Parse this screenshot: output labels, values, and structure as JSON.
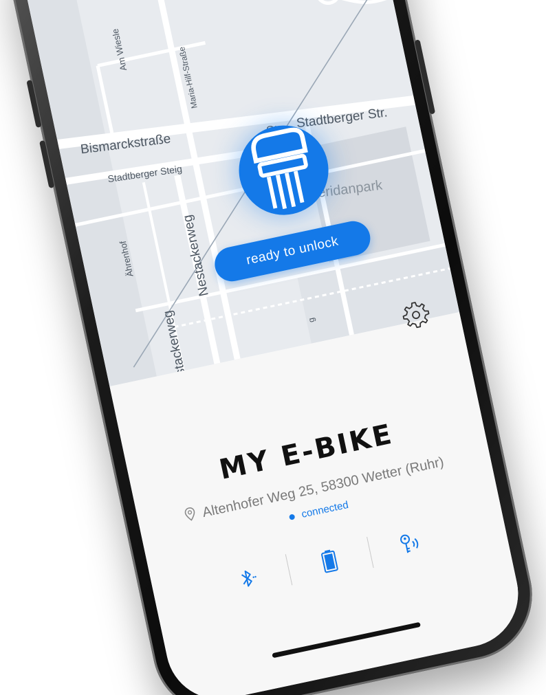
{
  "map": {
    "streets": [
      "Am Wiesle",
      "Maria-Hilf-Straße",
      "Bismarckstraße",
      "Str.",
      "Stadtberger Str.",
      "Stadtberger Steig",
      "Sheridanpark",
      "Nestackerweg",
      "Ährenhof",
      "Nestackerweg",
      "g"
    ]
  },
  "lock": {
    "icon": "lock-key-icon",
    "unlock_label": "ready to unlock"
  },
  "bike": {
    "title": "MY E-BIKE",
    "address": "Altenhofer Weg 25, 58300 Wetter (Ruhr)",
    "status": "connected"
  },
  "icons": {
    "settings": "gear-icon",
    "bluetooth": "bluetooth-icon",
    "battery": "battery-icon",
    "key": "key-wireless-icon",
    "pin": "location-pin-icon"
  },
  "colors": {
    "accent": "#1479e8",
    "map_bg": "#e8ebef",
    "panel_bg": "#f7f7f7"
  }
}
